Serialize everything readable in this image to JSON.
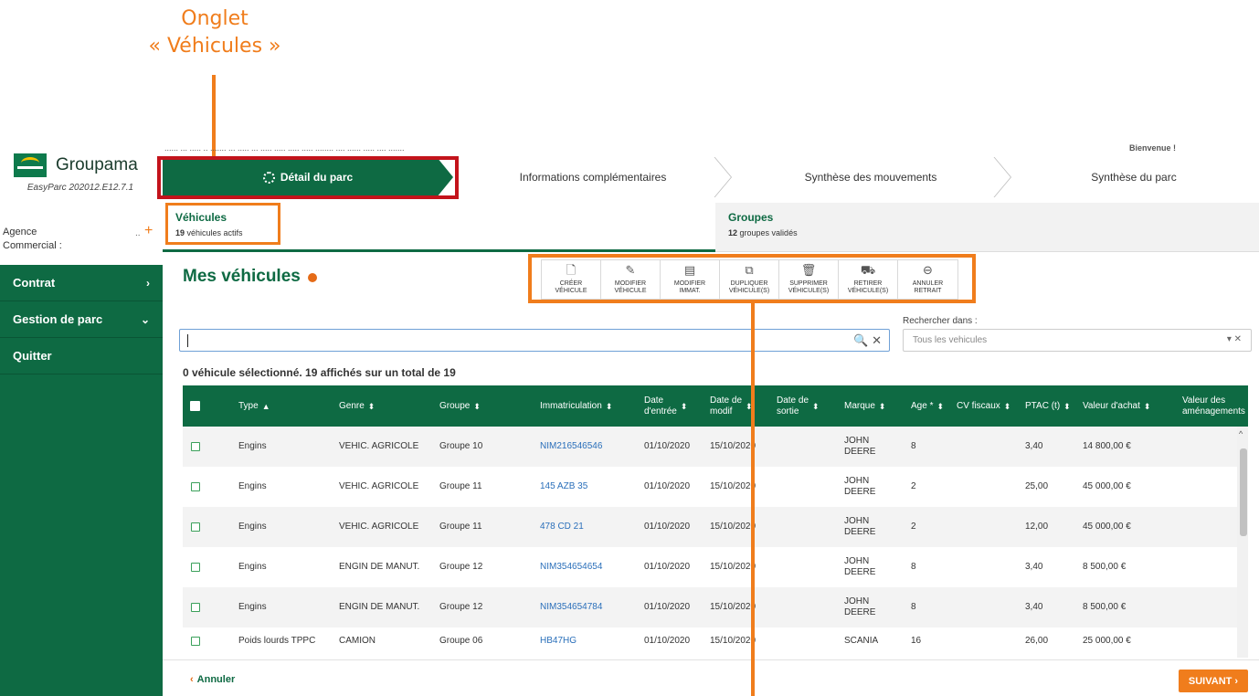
{
  "annotations": {
    "title_line1": "Onglet",
    "title_line2": "« Véhicules »"
  },
  "header": {
    "faint_line": "...... ... ..... .. ....... ... ..... ... ..... ..... ..... ..... ........ .... ...... ..... .... .......",
    "bienvenue": "Bienvenue !",
    "logo": "Groupama",
    "version": "EasyParc 202012.E12.7.1",
    "steps": [
      "Détail du parc",
      "Informations complémentaires",
      "Synthèse des mouvements",
      "Synthèse du parc"
    ]
  },
  "sidebar": {
    "agence_label": "Agence",
    "commercial_label": "Commercial :",
    "agence_dots": "..",
    "plus": "+",
    "items": [
      {
        "label": "Contrat",
        "chev": "›"
      },
      {
        "label": "Gestion de parc",
        "chev": "⌄"
      },
      {
        "label": "Quitter",
        "chev": ""
      }
    ]
  },
  "subtabs": {
    "vehicules": {
      "title": "Véhicules",
      "count": "19",
      "suffix": "véhicules actifs"
    },
    "groupes": {
      "title": "Groupes",
      "count": "12",
      "suffix": "groupes validés"
    }
  },
  "main": {
    "title": "Mes véhicules",
    "toolbar": [
      {
        "icon": "🗋",
        "line1": "CRÉER",
        "line2": "VÉHICULE"
      },
      {
        "icon": "✎",
        "line1": "MODIFIER",
        "line2": "VÉHICULE"
      },
      {
        "icon": "▤",
        "line1": "MODIFIER",
        "line2": "IMMAT."
      },
      {
        "icon": "⧉",
        "line1": "DUPLIQUER",
        "line2": "VÉHICULE(S)"
      },
      {
        "icon": "🗑",
        "line1": "SUPPRIMER",
        "line2": "VÉHICULE(S)"
      },
      {
        "icon": "⛟",
        "line1": "RETIRER",
        "line2": "VÉHICULE(S)"
      },
      {
        "icon": "⊖",
        "line1": "ANNULER",
        "line2": "RETRAIT"
      }
    ],
    "search_icons": "🔍 ✕",
    "rechercher_label": "Rechercher dans :",
    "rechercher_value": "Tous les vehicules",
    "rechercher_icons": "▾ ✕",
    "count_text": "0 véhicule sélectionné. 19 affichés sur un total de 19"
  },
  "table": {
    "columns": [
      {
        "label": "Type",
        "sort": "▲"
      },
      {
        "label": "Genre",
        "sort": "⬍"
      },
      {
        "label": "Groupe",
        "sort": "⬍"
      },
      {
        "label": "Immatriculation",
        "sort": "⬍"
      },
      {
        "label": "Date\nd'entrée",
        "sort": "⬍"
      },
      {
        "label": "Date de\nmodif",
        "sort": "⬍"
      },
      {
        "label": "Date de\nsortie",
        "sort": "⬍"
      },
      {
        "label": "Marque",
        "sort": "⬍"
      },
      {
        "label": "Age *",
        "sort": "⬍"
      },
      {
        "label": "CV fiscaux",
        "sort": "⬍"
      },
      {
        "label": "PTAC (t)",
        "sort": "⬍"
      },
      {
        "label": "Valeur d'achat",
        "sort": "⬍"
      },
      {
        "label": "Valeur des\naménagements",
        "sort": ""
      }
    ],
    "rows": [
      [
        "Engins",
        "VEHIC. AGRICOLE",
        "Groupe 10",
        "NIM216546546",
        "01/10/2020",
        "15/10/2020",
        "",
        "JOHN\nDEERE",
        "8",
        "",
        "3,40",
        "14 800,00 €",
        ""
      ],
      [
        "Engins",
        "VEHIC. AGRICOLE",
        "Groupe 11",
        "145 AZB 35",
        "01/10/2020",
        "15/10/2020",
        "",
        "JOHN\nDEERE",
        "2",
        "",
        "25,00",
        "45 000,00 €",
        ""
      ],
      [
        "Engins",
        "VEHIC. AGRICOLE",
        "Groupe 11",
        "478 CD 21",
        "01/10/2020",
        "15/10/2020",
        "",
        "JOHN\nDEERE",
        "2",
        "",
        "12,00",
        "45 000,00 €",
        ""
      ],
      [
        "Engins",
        "ENGIN DE MANUT.",
        "Groupe 12",
        "NIM354654654",
        "01/10/2020",
        "15/10/2020",
        "",
        "JOHN\nDEERE",
        "8",
        "",
        "3,40",
        "8 500,00 €",
        ""
      ],
      [
        "Engins",
        "ENGIN DE MANUT.",
        "Groupe 12",
        "NIM354654784",
        "01/10/2020",
        "15/10/2020",
        "",
        "JOHN\nDEERE",
        "8",
        "",
        "3,40",
        "8 500,00 €",
        ""
      ],
      [
        "Poids lourds TPPC",
        "CAMION",
        "Groupe 06",
        "HB47HG",
        "01/10/2020",
        "15/10/2020",
        "",
        "SCANIA",
        "16",
        "",
        "26,00",
        "25 000,00 €",
        ""
      ]
    ]
  },
  "footer": {
    "annuler": "Annuler",
    "annuler_icon": "‹",
    "suivant": "SUIVANT ›"
  },
  "colors": {
    "primary": "#0e6a43",
    "accent": "#f07d1c",
    "link": "#2a6fba"
  }
}
